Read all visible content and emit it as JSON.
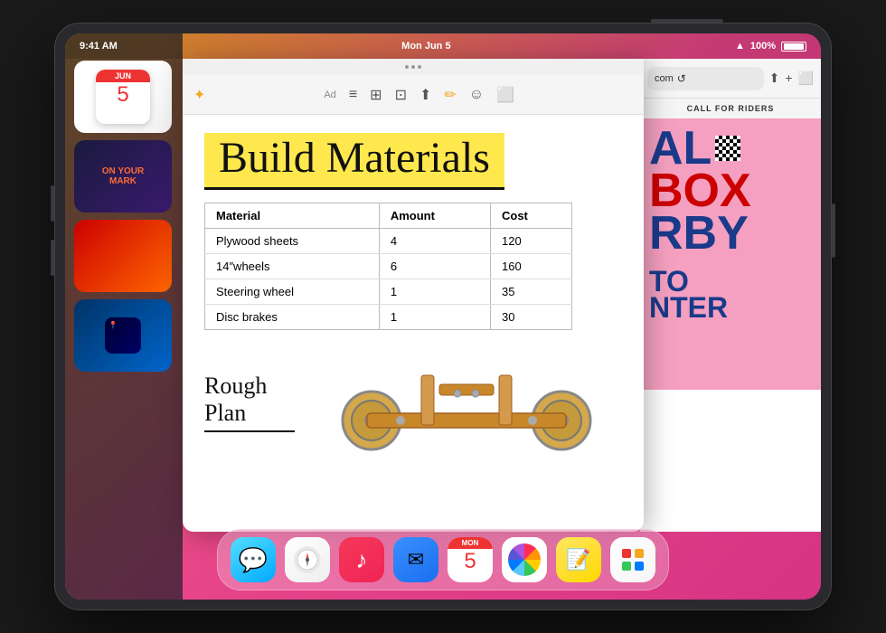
{
  "device": {
    "status_bar": {
      "time": "9:41 AM",
      "date": "Mon Jun 5",
      "battery": "100%"
    }
  },
  "notes": {
    "title": "Build Materials",
    "table": {
      "headers": [
        "Material",
        "Amount",
        "Cost"
      ],
      "rows": [
        [
          "Plywood sheets",
          "4",
          "120"
        ],
        [
          "14″wheels",
          "6",
          "160"
        ],
        [
          "Steering wheel",
          "1",
          "35"
        ],
        [
          "Disc brakes",
          "1",
          "30"
        ]
      ]
    },
    "rough_plan_label": "Rough Plan"
  },
  "browser": {
    "url": "com",
    "call_for_riders": "CALL FOR RIDERS",
    "derby_lines": [
      "AL",
      "BOX",
      "RBY"
    ],
    "auto_label": "TO",
    "nter_label": "NTER"
  },
  "dock": {
    "icons": [
      {
        "name": "Messages",
        "type": "messages"
      },
      {
        "name": "Safari",
        "type": "safari"
      },
      {
        "name": "Music",
        "type": "music"
      },
      {
        "name": "Mail",
        "type": "mail"
      },
      {
        "name": "Calendar",
        "type": "calendar",
        "day": "5",
        "month": "MON"
      },
      {
        "name": "Photos",
        "type": "photos"
      },
      {
        "name": "Notes",
        "type": "notes"
      },
      {
        "name": "App Store",
        "type": "apps"
      }
    ]
  },
  "toolbar": {
    "icons": [
      "✦",
      "Ad",
      "≡≡",
      "⊞",
      "⊡",
      "⬆",
      "✏",
      "☺",
      "✏"
    ]
  }
}
